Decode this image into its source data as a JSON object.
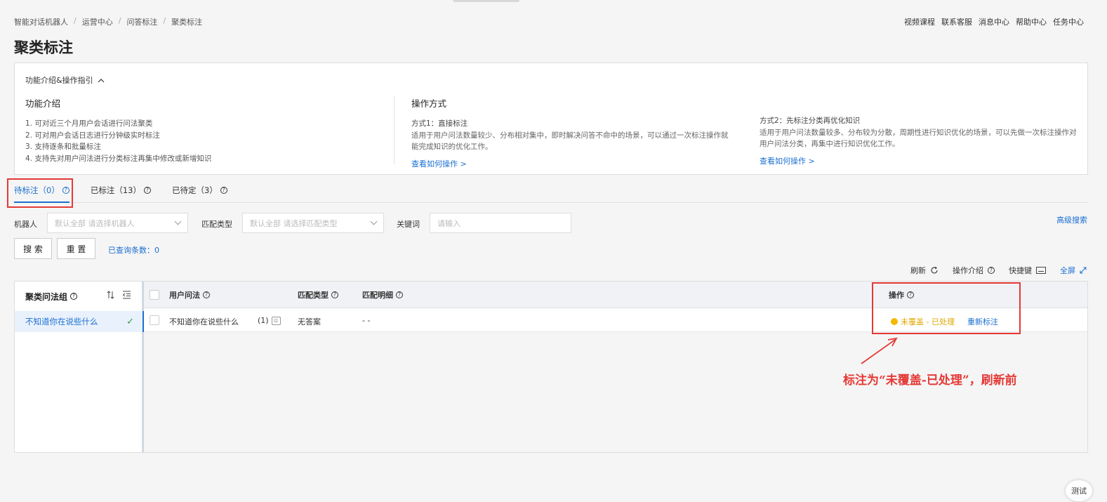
{
  "breadcrumb": [
    "智能对话机器人",
    "运营中心",
    "问答标注",
    "聚类标注"
  ],
  "top_links": [
    "视频课程",
    "联系客服",
    "消息中心",
    "帮助中心",
    "任务中心"
  ],
  "page_title": "聚类标注",
  "intro": {
    "toggle_label": "功能介绍&操作指引",
    "feature_title": "功能介绍",
    "features": [
      "1. 可对近三个月用户会话进行问法聚类",
      "2. 可对用户会话日志进行分钟级实时标注",
      "3. 支持逐条和批量标注",
      "4. 支持先对用户问法进行分类标注再集中修改或新增知识"
    ],
    "ops_title": "操作方式",
    "way1_title": "方式1：直接标注",
    "way1_desc": "适用于用户问法数量较少、分布相对集中，即时解决问答不命中的场景，可以通过一次标注操作就能完成知识的优化工作。",
    "way1_link": "查看如何操作 >",
    "way2_title": "方式2：先标注分类再优化知识",
    "way2_desc": "适用于用户问法数量较多、分布较为分散，周期性进行知识优化的场景，可以先做一次标注操作对用户问法分类，再集中进行知识优化工作。",
    "way2_link": "查看如何操作 >"
  },
  "tabs": [
    {
      "label": "待标注（0）"
    },
    {
      "label": "已标注（13）"
    },
    {
      "label": "已待定（3）"
    }
  ],
  "filters": {
    "robot_label": "机器人",
    "robot_placeholder": "默认全部 请选择机器人",
    "match_label": "匹配类型",
    "match_placeholder": "默认全部 请选择匹配类型",
    "keyword_label": "关键词",
    "keyword_placeholder": "请输入",
    "advanced": "高级搜索"
  },
  "buttons": {
    "search": "搜 索",
    "reset": "重 置"
  },
  "count_text": "已查询条数：0",
  "toolbar": {
    "refresh": "刷新",
    "op_intro": "操作介绍",
    "shortcut": "快捷键",
    "fullscreen": "全屏"
  },
  "left_panel": {
    "title": "聚类问法组",
    "item": "不知道你在说些什么"
  },
  "table": {
    "headers": {
      "question": "用户问法",
      "match_type": "匹配类型",
      "match_detail": "匹配明细",
      "operation": "操作"
    },
    "row": {
      "question": "不知道你在说些什么",
      "count": "(1)",
      "match_type": "无答案",
      "match_detail": "- -",
      "status": "未覆盖 - 已处理",
      "relabel": "重新标注"
    }
  },
  "annotation_text": "标注为“未覆盖-已处理”，刷新前",
  "test_button": "测试",
  "colors": {
    "primary": "#1b6fd1",
    "annotation": "#e53935",
    "status": "#f5b800"
  }
}
